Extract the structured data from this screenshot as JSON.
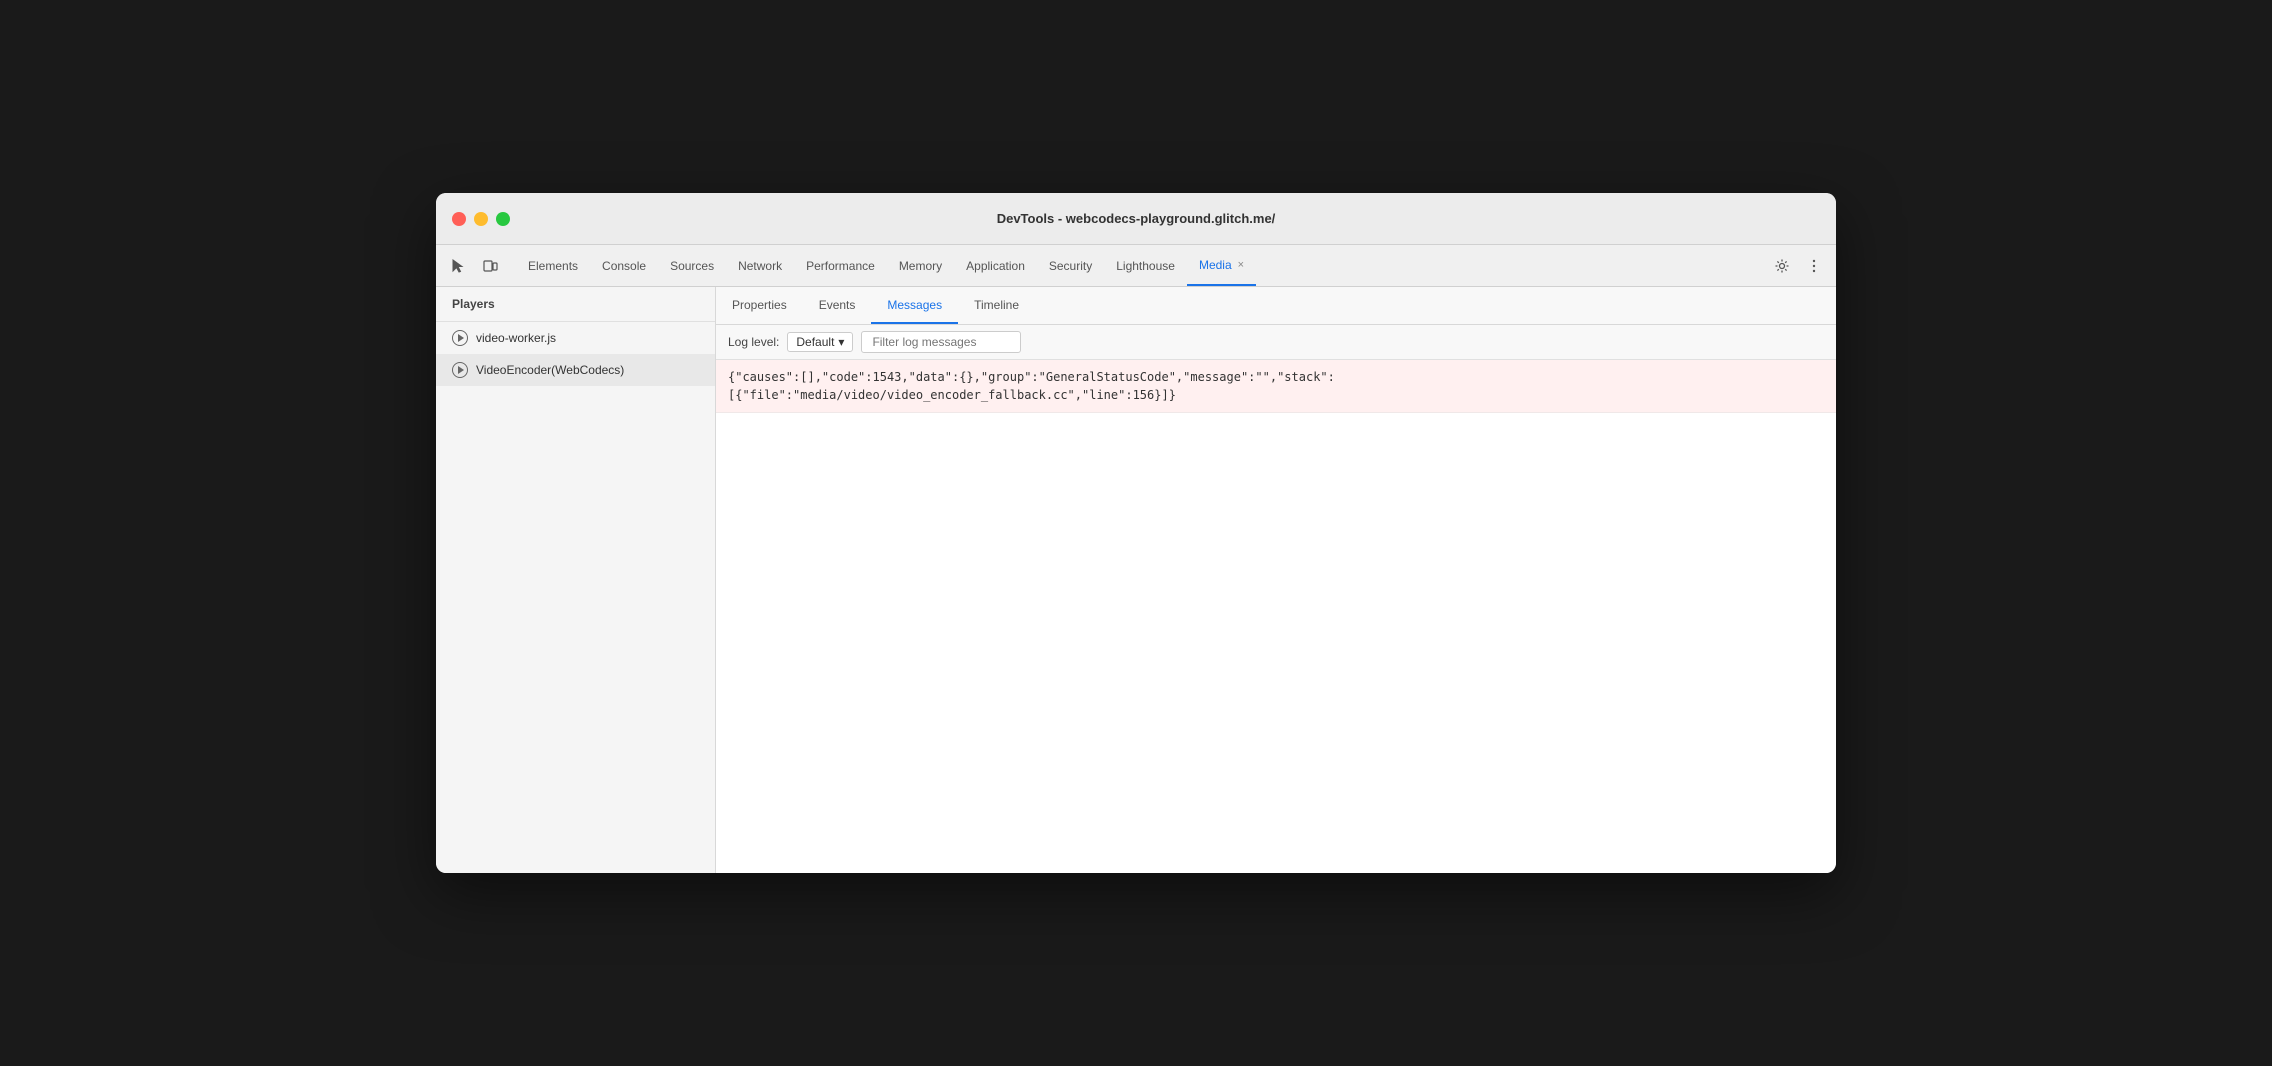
{
  "window": {
    "title": "DevTools - webcodecs-playground.glitch.me/"
  },
  "traffic_lights": {
    "close_label": "close",
    "minimize_label": "minimize",
    "maximize_label": "maximize"
  },
  "toolbar": {
    "icons": [
      {
        "name": "cursor-icon",
        "symbol": "⬡",
        "label": "Cursor"
      },
      {
        "name": "device-icon",
        "symbol": "▣",
        "label": "Device"
      }
    ],
    "tabs": [
      {
        "id": "elements",
        "label": "Elements",
        "active": false
      },
      {
        "id": "console",
        "label": "Console",
        "active": false
      },
      {
        "id": "sources",
        "label": "Sources",
        "active": false
      },
      {
        "id": "network",
        "label": "Network",
        "active": false
      },
      {
        "id": "performance",
        "label": "Performance",
        "active": false
      },
      {
        "id": "memory",
        "label": "Memory",
        "active": false
      },
      {
        "id": "application",
        "label": "Application",
        "active": false
      },
      {
        "id": "security",
        "label": "Security",
        "active": false
      },
      {
        "id": "lighthouse",
        "label": "Lighthouse",
        "active": false
      },
      {
        "id": "media",
        "label": "Media",
        "active": true,
        "closable": true,
        "close_symbol": "×"
      }
    ],
    "right_icons": [
      {
        "name": "settings-icon",
        "symbol": "⚙"
      },
      {
        "name": "more-icon",
        "symbol": "⋮"
      }
    ]
  },
  "sidebar": {
    "header": "Players",
    "items": [
      {
        "id": "video-worker",
        "label": "video-worker.js",
        "selected": false
      },
      {
        "id": "video-encoder",
        "label": "VideoEncoder(WebCodecs)",
        "selected": true
      }
    ]
  },
  "panel": {
    "tabs": [
      {
        "id": "properties",
        "label": "Properties",
        "active": false
      },
      {
        "id": "events",
        "label": "Events",
        "active": false
      },
      {
        "id": "messages",
        "label": "Messages",
        "active": true
      },
      {
        "id": "timeline",
        "label": "Timeline",
        "active": false
      }
    ],
    "log_controls": {
      "level_label": "Log level:",
      "level_value": "Default",
      "level_arrow": "▾",
      "filter_placeholder": "Filter log messages"
    },
    "log_entries": [
      {
        "id": "entry-1",
        "type": "error",
        "text": "{\"causes\":[],\"code\":1543,\"data\":{},\"group\":\"GeneralStatusCode\",\"message\":\"\",\"stack\":\n[{\"file\":\"media/video/video_encoder_fallback.cc\",\"line\":156}]}"
      }
    ]
  }
}
